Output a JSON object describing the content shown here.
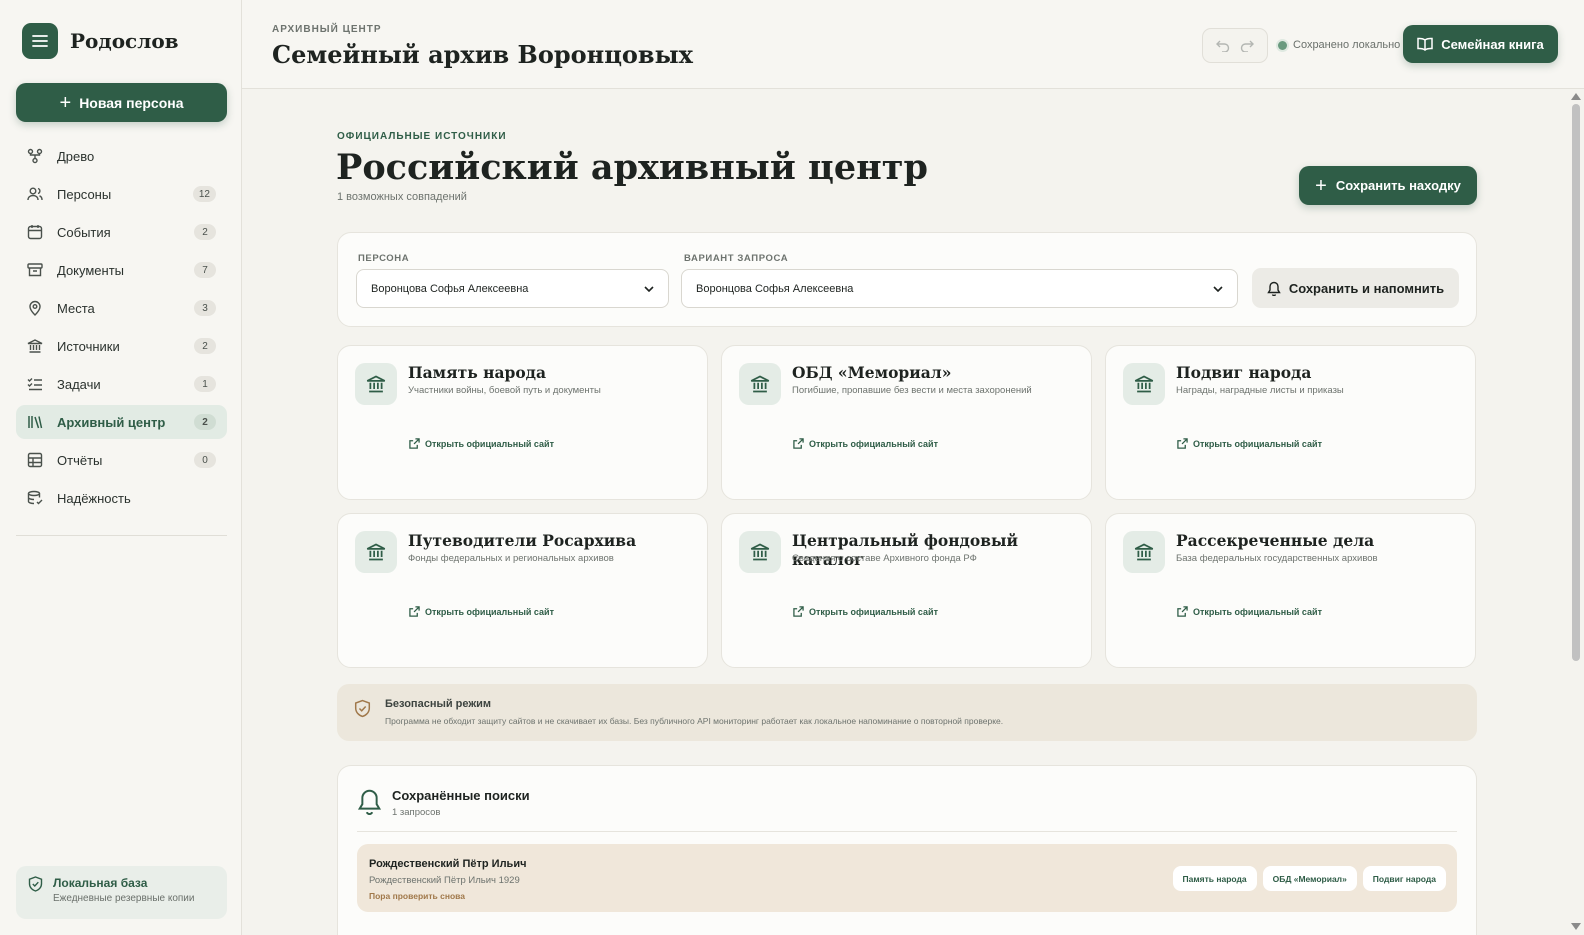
{
  "brand": {
    "name": "Родослов"
  },
  "sidebar": {
    "new_person_label": "Новая персона",
    "items": [
      {
        "label": "Древо",
        "count": ""
      },
      {
        "label": "Персоны",
        "count": "12"
      },
      {
        "label": "События",
        "count": "2"
      },
      {
        "label": "Документы",
        "count": "7"
      },
      {
        "label": "Места",
        "count": "3"
      },
      {
        "label": "Источники",
        "count": "2"
      },
      {
        "label": "Задачи",
        "count": "1"
      },
      {
        "label": "Архивный центр",
        "count": "2"
      },
      {
        "label": "Отчёты",
        "count": "0"
      },
      {
        "label": "Надёжность",
        "count": ""
      }
    ],
    "local_db": {
      "title": "Локальная база",
      "subtitle": "Ежедневные резервные копии"
    }
  },
  "header": {
    "kicker": "АРХИВНЫЙ ЦЕНТР",
    "title": "Семейный архив Воронцовых",
    "saved_status": "Сохранено локально",
    "family_book_label": "Семейная книга"
  },
  "main": {
    "kicker": "ОФИЦИАЛЬНЫЕ ИСТОЧНИКИ",
    "title": "Российский архивный центр",
    "matches": "1 возможных совпадений",
    "save_find_label": "Сохранить находку",
    "query": {
      "person_label": "ПЕРСОНА",
      "person_value": "Воронцова Софья Алексеевна",
      "variant_label": "ВАРИАНТ ЗАПРОСА",
      "variant_value": "Воронцова Софья Алексеевна",
      "remind_label": "Сохранить и напомнить"
    },
    "sources": [
      {
        "title": "Память народа",
        "desc": "Участники войны, боевой путь и документы",
        "link": "Открыть официальный сайт"
      },
      {
        "title": "ОБД «Мемориал»",
        "desc": "Погибшие, пропавшие без вести и места захоронений",
        "link": "Открыть официальный сайт"
      },
      {
        "title": "Подвиг народа",
        "desc": "Награды, наградные листы и приказы",
        "link": "Открыть официальный сайт"
      },
      {
        "title": "Путеводители Росархива",
        "desc": "Фонды федеральных и региональных архивов",
        "link": "Открыть официальный сайт"
      },
      {
        "title": "Центральный фондовый каталог",
        "desc": "Сведения о составе Архивного фонда РФ",
        "link": "Открыть официальный сайт"
      },
      {
        "title": "Рассекреченные дела",
        "desc": "База федеральных государственных архивов",
        "link": "Открыть официальный сайт"
      }
    ],
    "safe_mode": {
      "title": "Безопасный режим",
      "text": "Программа не обходит защиту сайтов и не скачивает их базы. Без публичного API мониторинг работает как локальное напоминание о повторной проверке."
    },
    "saved_searches": {
      "title": "Сохранённые поиски",
      "count": "1 запросов",
      "items": [
        {
          "name": "Рождественский Пётр Ильич",
          "query": "Рождественский Пётр Ильич 1929",
          "status": "Пора проверить снова",
          "chips": [
            "Память народа",
            "ОБД «Мемориал»",
            "Подвиг народа"
          ]
        }
      ]
    }
  },
  "colors": {
    "accent": "#2f5d47",
    "background": "#f4f3ee",
    "warning": "#a0784a"
  },
  "icons": [
    "menu-icon",
    "plus-icon",
    "tree-icon",
    "users-icon",
    "calendar-icon",
    "archive-box-icon",
    "map-pin-icon",
    "bank-icon",
    "checklist-icon",
    "books-icon",
    "table-icon",
    "database-icon",
    "shield-check-icon",
    "undo-icon",
    "redo-icon",
    "book-open-icon",
    "bell-icon",
    "external-link-icon",
    "chevron-down-icon"
  ]
}
